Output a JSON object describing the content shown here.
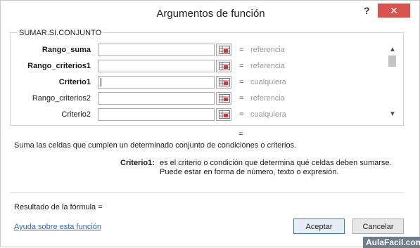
{
  "window": {
    "title": "Argumentos de función",
    "help_glyph": "?",
    "close_glyph": "✕"
  },
  "function_group": {
    "name": "SUMAR.SI.CONJUNTO",
    "rows": [
      {
        "label": "Rango_suma",
        "bold": true,
        "value": "",
        "equals": "=",
        "hint": "referencia"
      },
      {
        "label": "Rango_criterios1",
        "bold": true,
        "value": "",
        "equals": "=",
        "hint": "referencia"
      },
      {
        "label": "Criterio1",
        "bold": true,
        "value": "",
        "equals": "=",
        "hint": "cualquiera"
      },
      {
        "label": "Rango_criterios2",
        "bold": false,
        "value": "",
        "equals": "=",
        "hint": "referencia"
      },
      {
        "label": "Criterio2",
        "bold": false,
        "value": "",
        "equals": "=",
        "hint": "cualquiera"
      }
    ]
  },
  "result_equals": "=",
  "description": "Suma las celdas que cumplen un determinado conjunto de condiciones o criterios.",
  "argument_help": {
    "name": "Criterio1:",
    "line1": "es el criterio o condición que determina qué celdas deben sumarse.",
    "line2": "Puede estar en forma de número, texto o expresión."
  },
  "formula_result_label": "Resultado de la fórmula =",
  "help_link": "Ayuda sobre esta función",
  "buttons": {
    "ok": "Aceptar",
    "cancel": "Cancelar"
  },
  "watermark": "AulaFacil.com"
}
